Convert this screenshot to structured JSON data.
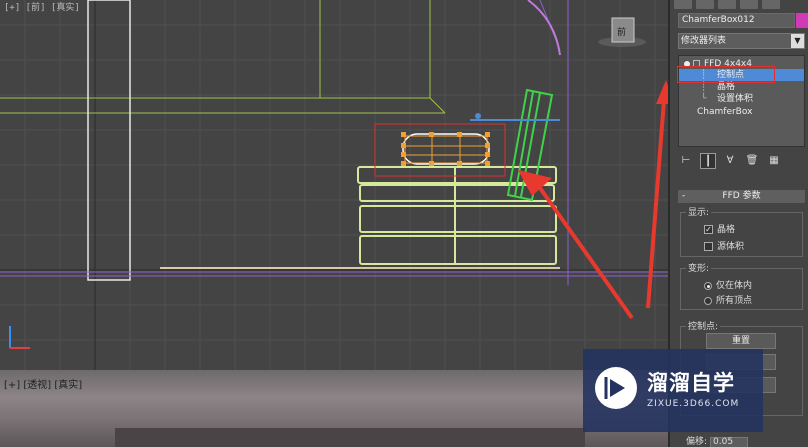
{
  "viewport": {
    "label": "[+] [前] [真实]"
  },
  "viewport_bottom": {
    "tabs": "[+] [透视] [真实]"
  },
  "panel": {
    "object_name": "ChamferBox012",
    "object_color": "#d03bb5",
    "modifier_list_label": "修改器列表",
    "stack": {
      "ffd": "FFD 4x4x4",
      "control_points": "控制点",
      "lattice": "晶格",
      "set_volume": "设置体积",
      "base": "ChamferBox"
    },
    "rollout_title": "FFD 参数",
    "display": {
      "label": "显示:",
      "lattice": "晶格",
      "source_volume": "源体积"
    },
    "deform": {
      "label": "变形:",
      "only_in_volume": "仅在体内",
      "all_vertices": "所有顶点"
    },
    "control_points_group": {
      "label": "控制点:",
      "reset": "重置"
    },
    "offset_label": "偏移:",
    "offset_value": "0.05"
  },
  "watermark": {
    "title": "溜溜自学",
    "sub": "ZIXUE.3D66.COM"
  },
  "colors": {
    "highlight_box": "#e03030",
    "selection": "#4f8ad6",
    "arrow": "#e8392e"
  }
}
